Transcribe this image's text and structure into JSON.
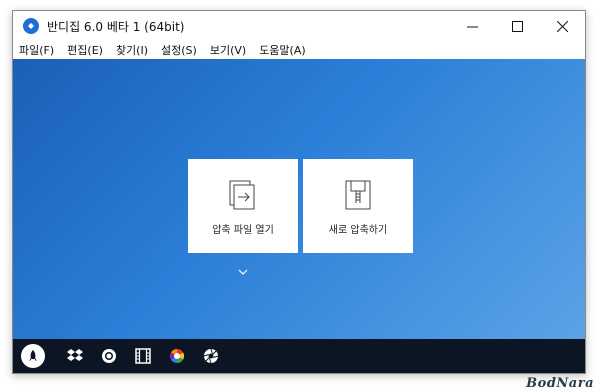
{
  "window": {
    "title": "반디집 6.0 베타 1 (64bit)"
  },
  "menu": [
    "파일(F)",
    "편집(E)",
    "찾기(I)",
    "설정(S)",
    "보기(V)",
    "도움말(A)"
  ],
  "cards": {
    "open_label": "압축 파일 열기",
    "new_label": "새로 압축하기"
  },
  "icons": {
    "app": "bandizip-icon",
    "taskbar": [
      "rocket-icon",
      "dropbox-icon",
      "circle-icon",
      "film-icon",
      "color-wheel-icon",
      "aperture-icon"
    ]
  },
  "colors": {
    "accent": "#1e6fd1",
    "taskbar": "#0c1524"
  },
  "watermark": "BodNara"
}
